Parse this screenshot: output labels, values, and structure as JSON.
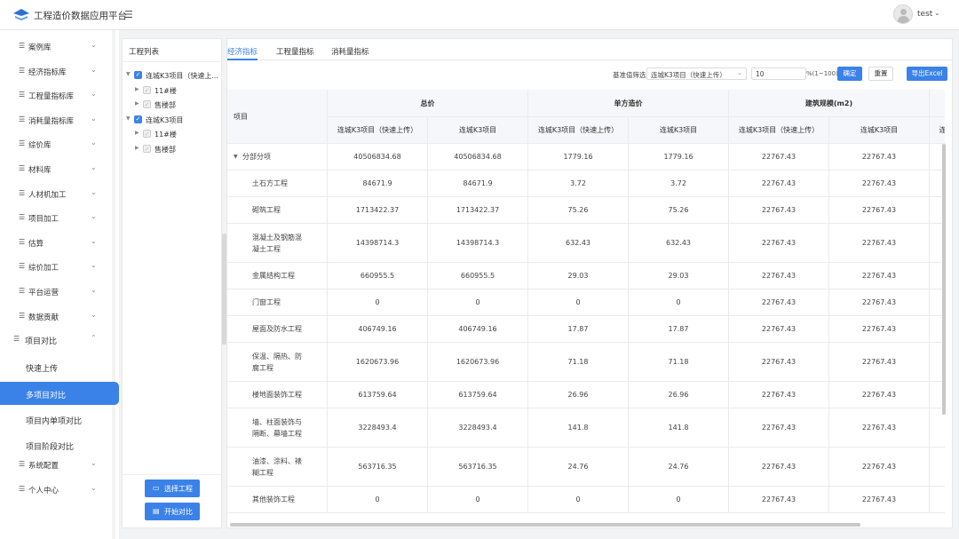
{
  "app": {
    "title": "工程造价数据应用平台",
    "fold_icon": "fold-menu-icon"
  },
  "user": {
    "name": "test",
    "caret": "⌄"
  },
  "sidebar": {
    "items": [
      {
        "label": "案例库"
      },
      {
        "label": "经济指标库"
      },
      {
        "label": "工程量指标库"
      },
      {
        "label": "消耗量指标库"
      },
      {
        "label": "综价库"
      },
      {
        "label": "材料库"
      },
      {
        "label": "人材机加工"
      },
      {
        "label": "项目加工"
      },
      {
        "label": "估算"
      },
      {
        "label": "综价加工"
      },
      {
        "label": "平台运营"
      },
      {
        "label": "数据贡献"
      }
    ],
    "open_group": {
      "label": "项目对比"
    },
    "submenu": [
      {
        "label": "快速上传"
      },
      {
        "label": "多项目对比"
      },
      {
        "label": "项目内单项对比"
      },
      {
        "label": "项目阶段对比"
      }
    ],
    "bottom_items": [
      {
        "label": "系统配置"
      },
      {
        "label": "个人中心"
      }
    ],
    "item_icon": "☰",
    "caret": "⌄",
    "caret_up": "⌃"
  },
  "project_panel": {
    "title": "工程列表",
    "tree": [
      {
        "label": "连城K3项目（快速上...",
        "children": [
          "11#楼",
          "售楼部"
        ]
      },
      {
        "label": "连城K3项目",
        "children": [
          "11#楼",
          "售楼部"
        ]
      }
    ],
    "select_button": "选择工程",
    "compare_button": "开始对比"
  },
  "main": {
    "tabs": [
      "经济指标",
      "工程量指标",
      "消耗量指标"
    ],
    "filter_label": "基准值筛选",
    "filter_value": "连城K3项目（快速上传）",
    "number_value": "10",
    "range_hint": "%(1~100)",
    "confirm_button": "确定",
    "reset_button": "重置",
    "export_button": "导出Excel"
  },
  "table": {
    "project_header": "项目",
    "groups": [
      "总价",
      "单方造价",
      "建筑规模(m2)"
    ],
    "sub_headers": [
      "连城K3项目（快速上传）",
      "连城K3项目",
      "连城K3项目（快速上传）",
      "连城K3项目",
      "连城K3项目（快速上传）",
      "连城K3项目",
      "连"
    ],
    "rows": [
      {
        "name": "分部分项",
        "values": [
          "40506834.68",
          "40506834.68",
          "1779.16",
          "1779.16",
          "22767.43",
          "22767.43"
        ]
      },
      {
        "name": "土石方工程",
        "values": [
          "84671.9",
          "84671.9",
          "3.72",
          "3.72",
          "22767.43",
          "22767.43"
        ]
      },
      {
        "name": "砌筑工程",
        "values": [
          "1713422.37",
          "1713422.37",
          "75.26",
          "75.26",
          "22767.43",
          "22767.43"
        ]
      },
      {
        "name": "混凝土及钢筋混凝土工程",
        "values": [
          "14398714.3",
          "14398714.3",
          "632.43",
          "632.43",
          "22767.43",
          "22767.43"
        ]
      },
      {
        "name": "金属结构工程",
        "values": [
          "660955.5",
          "660955.5",
          "29.03",
          "29.03",
          "22767.43",
          "22767.43"
        ]
      },
      {
        "name": "门窗工程",
        "values": [
          "0",
          "0",
          "0",
          "0",
          "22767.43",
          "22767.43"
        ]
      },
      {
        "name": "屋面及防水工程",
        "values": [
          "406749.16",
          "406749.16",
          "17.87",
          "17.87",
          "22767.43",
          "22767.43"
        ]
      },
      {
        "name": "保温、隔热、防腐工程",
        "values": [
          "1620673.96",
          "1620673.96",
          "71.18",
          "71.18",
          "22767.43",
          "22767.43"
        ]
      },
      {
        "name": "楼地面装饰工程",
        "values": [
          "613759.64",
          "613759.64",
          "26.96",
          "26.96",
          "22767.43",
          "22767.43"
        ]
      },
      {
        "name": "墙、柱面装饰与隔断、幕墙工程",
        "values": [
          "3228493.4",
          "3228493.4",
          "141.8",
          "141.8",
          "22767.43",
          "22767.43"
        ]
      },
      {
        "name": "油漆、涂料、裱糊工程",
        "values": [
          "563716.35",
          "563716.35",
          "24.76",
          "24.76",
          "22767.43",
          "22767.43"
        ]
      },
      {
        "name": "其他装饰工程",
        "values": [
          "0",
          "0",
          "0",
          "0",
          "22767.43",
          "22767.43"
        ]
      }
    ]
  },
  "colors": {
    "accent": "#3b82e8"
  }
}
